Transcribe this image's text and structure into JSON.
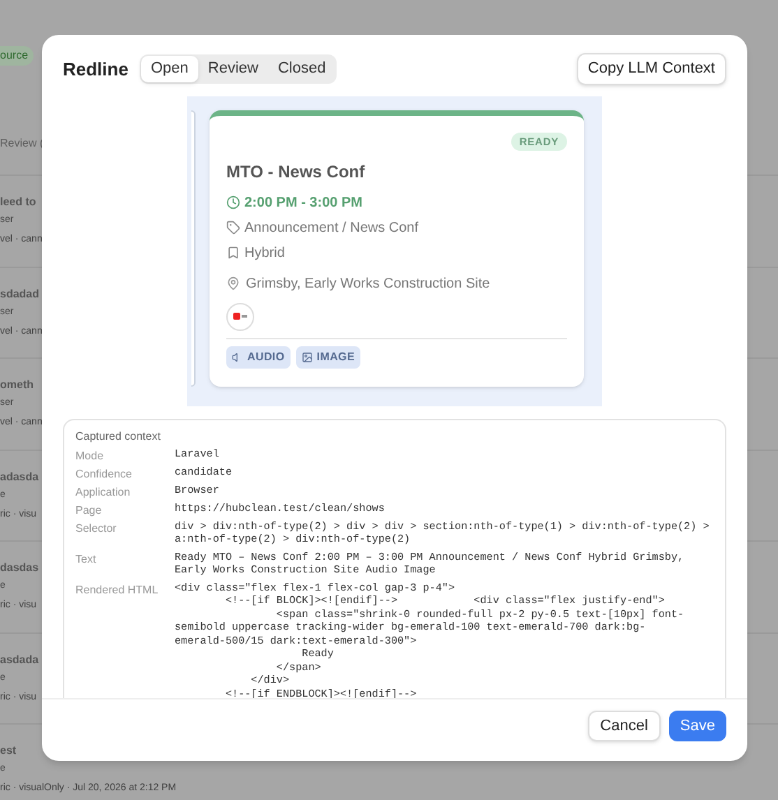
{
  "background": {
    "badge": "ource",
    "tab": "Review (",
    "items": [
      {
        "title": "leed to",
        "line_1": "ser",
        "line_2": "vel · cann"
      },
      {
        "title": "sdadad",
        "line_1": "ser",
        "line_2": "vel · cann"
      },
      {
        "title": "ometh",
        "line_1": "ser",
        "line_2": "vel · cann"
      },
      {
        "title": "adasda",
        "line_1": "e",
        "line_2": "ric · visu"
      },
      {
        "title": "dasdas",
        "line_1": "e",
        "line_2": "ric · visu"
      },
      {
        "title": "asdada",
        "line_1": "e",
        "line_2": "ric · visu"
      },
      {
        "title": "est",
        "line_1": "e",
        "line_2": "ric · visualOnly · Jul 20, 2026 at 2:12 PM"
      }
    ]
  },
  "dialog": {
    "title": "Redline",
    "tabs": [
      {
        "label": "Open",
        "selected": true
      },
      {
        "label": "Review",
        "selected": false
      },
      {
        "label": "Closed",
        "selected": false
      }
    ],
    "copy_button": "Copy LLM Context",
    "preview": {
      "badge": "READY",
      "title": "MTO - News Conf",
      "time": "2:00 PM - 3:00 PM",
      "category": "Announcement / News Conf",
      "format": "Hybrid",
      "location": "Grimsby, Early Works Construction Site",
      "chips": [
        {
          "kind": "audio",
          "label": "AUDIO"
        },
        {
          "kind": "image",
          "label": "IMAGE"
        }
      ]
    },
    "context": {
      "heading": "Captured context",
      "rows": [
        {
          "label": "Mode",
          "value": [
            "Laravel"
          ]
        },
        {
          "label": "Confidence",
          "value": [
            "candidate"
          ]
        },
        {
          "label": "Application",
          "value": [
            "Browser"
          ]
        },
        {
          "label": "Page",
          "value": [
            "https://hubclean.test/clean/shows"
          ]
        },
        {
          "label": "Selector",
          "value": [
            "div > div:nth-of-type(2) > div > div > section:nth-of-type(1) > div:nth-of-type(2) >",
            "a:nth-of-type(2) > div:nth-of-type(2)"
          ]
        },
        {
          "label": "Text",
          "value": [
            "Ready MTO – News Conf 2:00 PM – 3:00 PM Announcement / News Conf Hybrid Grimsby,",
            "Early Works Construction Site Audio Image"
          ]
        },
        {
          "label": "Rendered HTML",
          "value": [
            "<div class=\"flex flex-1 flex-col gap-3 p-4\">",
            "        <!--[if BLOCK]><![endif]-->            <div class=\"flex justify-end\">",
            "                <span class=\"shrink-0 rounded-full px-2 py-0.5 text-[10px] font-",
            "semibold uppercase tracking-wider bg-emerald-100 text-emerald-700 dark:bg-",
            "emerald-500/15 dark:text-emerald-300\">",
            "                    Ready",
            "                </span>",
            "            </div>",
            "        <!--[if ENDBLOCK]><![endif]-->"
          ]
        }
      ]
    },
    "buttons": [
      {
        "kind": "secondary",
        "label": "Cancel"
      },
      {
        "kind": "primary",
        "label": "Save"
      }
    ]
  }
}
